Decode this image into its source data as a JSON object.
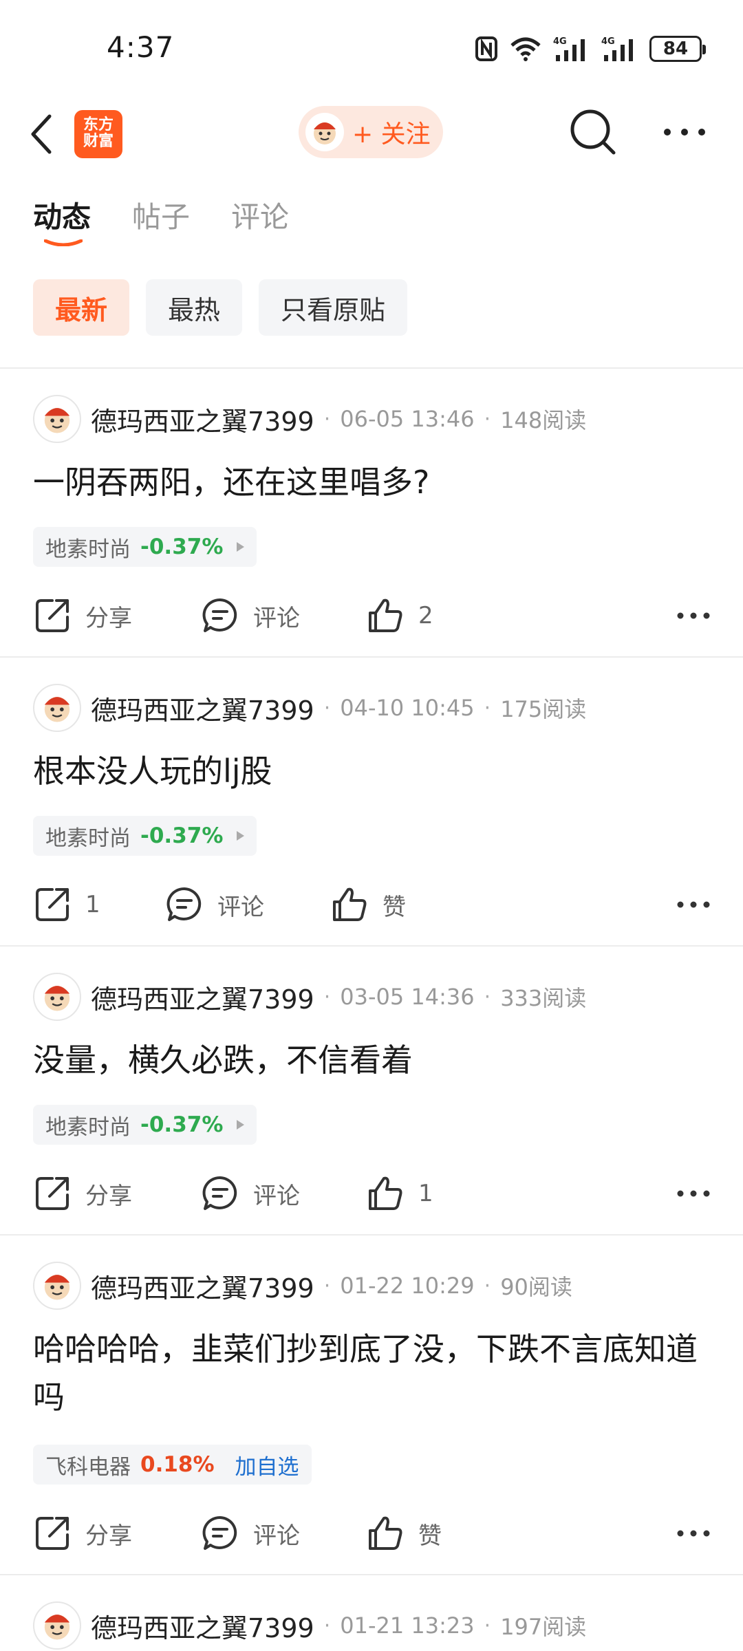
{
  "status_bar": {
    "time": "4:37",
    "battery": "84",
    "net_1": "4G",
    "net_2": "4G"
  },
  "header": {
    "logo_line1": "东方",
    "logo_line2": "财富",
    "follow_label": "+ 关注"
  },
  "tabs": [
    {
      "label": "动态",
      "active": true
    },
    {
      "label": "帖子",
      "active": false
    },
    {
      "label": "评论",
      "active": false
    }
  ],
  "filters": [
    {
      "label": "最新",
      "active": true
    },
    {
      "label": "最热",
      "active": false
    },
    {
      "label": "只看原贴",
      "active": false
    }
  ],
  "colors": {
    "accent": "#ff5a1f",
    "stock_down": "#2eaa4f",
    "stock_up": "#e9491f",
    "link": "#1e6fcf"
  },
  "posts": [
    {
      "username": "德玛西亚之翼7399",
      "date": "06-05 13:46",
      "reads": "148阅读",
      "title": "一阴吞两阳，还在这里唱多?",
      "stock": {
        "name": "地素时尚",
        "change": "-0.37%",
        "trend": "down",
        "action": ""
      },
      "share_label": "分享",
      "comment_label": "评论",
      "like_label": "2"
    },
    {
      "username": "德玛西亚之翼7399",
      "date": "04-10 10:45",
      "reads": "175阅读",
      "title": "根本没人玩的lj股",
      "stock": {
        "name": "地素时尚",
        "change": "-0.37%",
        "trend": "down",
        "action": ""
      },
      "share_label": "1",
      "comment_label": "评论",
      "like_label": "赞"
    },
    {
      "username": "德玛西亚之翼7399",
      "date": "03-05 14:36",
      "reads": "333阅读",
      "title": "没量，横久必跌，不信看着",
      "stock": {
        "name": "地素时尚",
        "change": "-0.37%",
        "trend": "down",
        "action": ""
      },
      "share_label": "分享",
      "comment_label": "评论",
      "like_label": "1"
    },
    {
      "username": "德玛西亚之翼7399",
      "date": "01-22 10:29",
      "reads": "90阅读",
      "title": "哈哈哈哈，韭菜们抄到底了没，下跌不言底知道吗",
      "stock": {
        "name": "飞科电器",
        "change": "0.18%",
        "trend": "up",
        "action": "加自选"
      },
      "share_label": "分享",
      "comment_label": "评论",
      "like_label": "赞"
    },
    {
      "username": "德玛西亚之翼7399",
      "date": "01-21 13:23",
      "reads": "197阅读"
    }
  ]
}
